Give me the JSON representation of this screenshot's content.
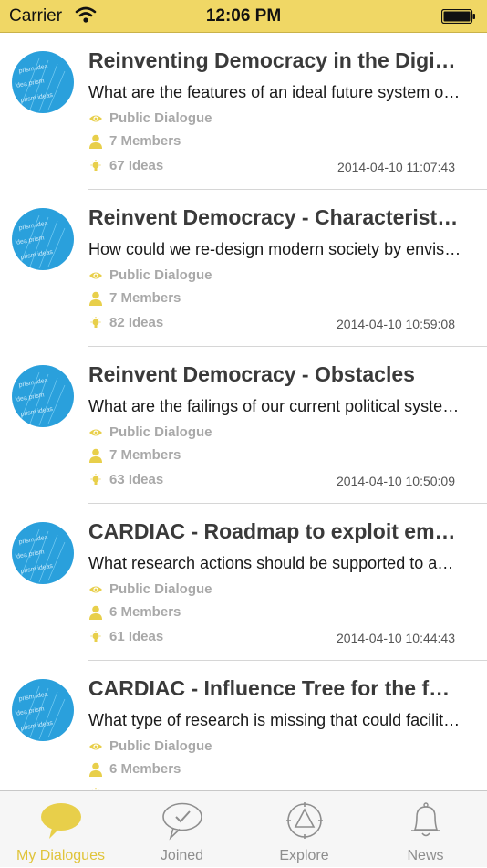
{
  "status_bar": {
    "carrier": "Carrier",
    "time": "12:06 PM"
  },
  "dialogues": [
    {
      "title": "Reinventing Democracy in the Digital Age",
      "description": "What are the features of an ideal future system of governance?",
      "visibility": "Public Dialogue",
      "members": "7 Members",
      "ideas": "67 Ideas",
      "date": "2014-04-10 11:07:43"
    },
    {
      "title": "Reinvent Democracy - Characteristics",
      "description": "How could we re-design modern society by envisioning new forms?",
      "visibility": "Public Dialogue",
      "members": "7 Members",
      "ideas": "82 Ideas",
      "date": "2014-04-10 10:59:08"
    },
    {
      "title": "Reinvent Democracy - Obstacles",
      "description": "What are the failings of our current political system?",
      "visibility": "Public Dialogue",
      "members": "7 Members",
      "ideas": "63 Ideas",
      "date": "2014-04-10 10:50:09"
    },
    {
      "title": "CARDIAC - Roadmap to exploit emerging research",
      "description": "What research actions should be supported to advance the field?",
      "visibility": "Public Dialogue",
      "members": "6 Members",
      "ideas": "61 Ideas",
      "date": "2014-04-10 10:44:43"
    },
    {
      "title": "CARDIAC - Influence Tree for the future of research",
      "description": "What type of research is missing that could facilitate progress?",
      "visibility": "Public Dialogue",
      "members": "6 Members",
      "ideas": "",
      "date": ""
    }
  ],
  "tabs": [
    {
      "label": "My Dialogues",
      "icon": "speech-bubble-icon",
      "active": true
    },
    {
      "label": "Joined",
      "icon": "check-bubble-icon",
      "active": false
    },
    {
      "label": "Explore",
      "icon": "compass-icon",
      "active": false
    },
    {
      "label": "News",
      "icon": "bell-icon",
      "active": false
    }
  ],
  "colors": {
    "accent": "#e8cf4a",
    "status_bar": "#f0d765",
    "avatar": "#2aa0dc",
    "meta_text": "#a9a9a9"
  }
}
